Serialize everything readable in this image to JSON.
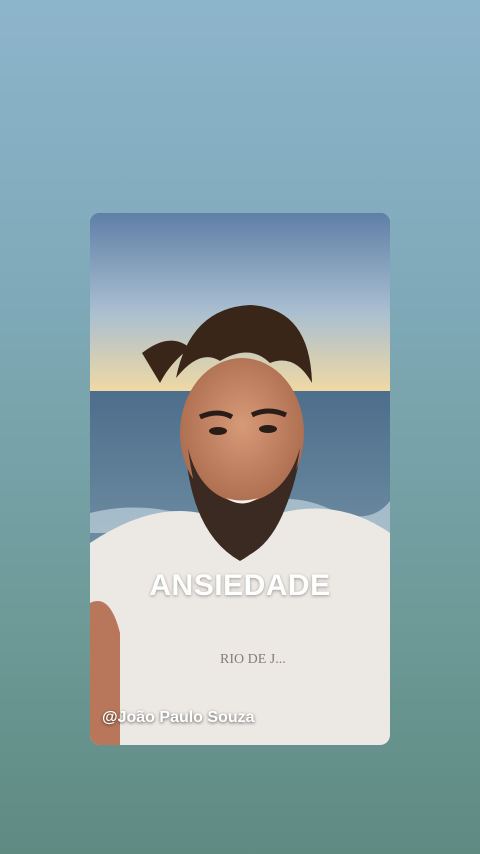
{
  "story": {
    "overlay_title": "ANSIEDADE",
    "credit": "@João Paulo Souza",
    "scene_description_icon": "video-frame-image"
  },
  "colors": {
    "background_top": "#8db4cb",
    "background_bottom": "#5f8a82",
    "text": "#ffffff"
  }
}
